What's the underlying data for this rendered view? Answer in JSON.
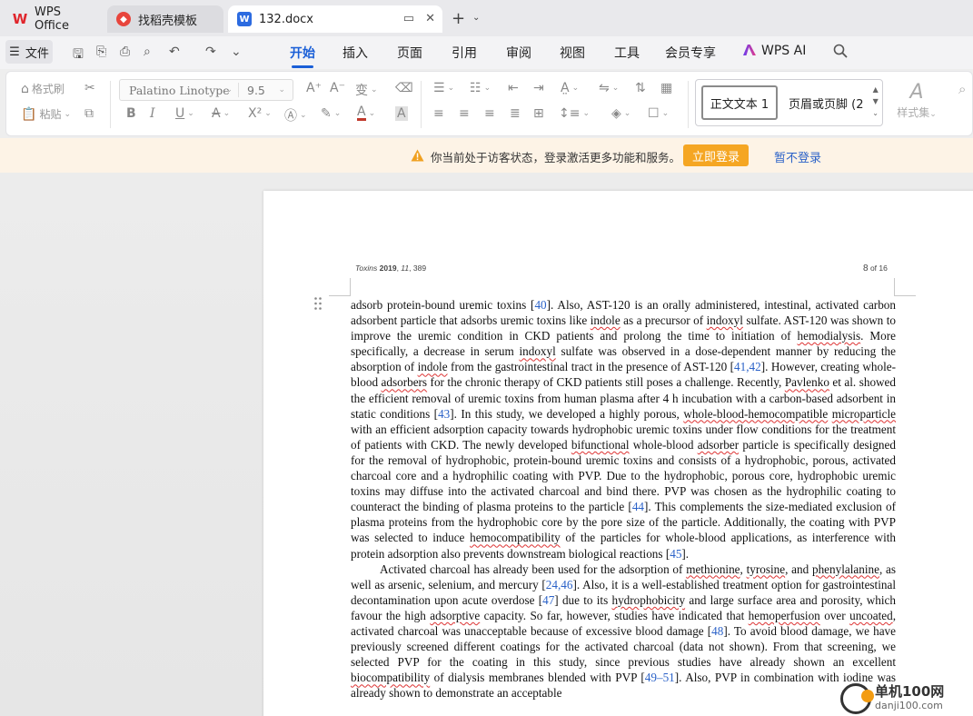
{
  "tabs": [
    {
      "label": "WPS Office"
    },
    {
      "label": "找稻壳模板"
    },
    {
      "label": "132.docx"
    }
  ],
  "menubar": {
    "file": "文件",
    "items": [
      "开始",
      "插入",
      "页面",
      "引用",
      "审阅",
      "视图",
      "工具",
      "会员专享",
      "WPS AI"
    ],
    "active": "开始"
  },
  "ribbon": {
    "format_painter": "格式刷",
    "paste": "粘贴",
    "font_name": "Palatino Linotype",
    "font_size": "9.5",
    "style_normal": "正文文本 1",
    "style_header": "页眉或页脚 (2",
    "style_set": "样式集"
  },
  "notice": {
    "text": "你当前处于访客状态，登录激活更多功能和服务。",
    "login": "立即登录",
    "skip": "暂不登录"
  },
  "document": {
    "running_head_journal": "Toxins",
    "running_head_year": "2019",
    "running_head_vol": "11",
    "running_head_page": "389",
    "page_num": "8",
    "page_of": "of 16"
  },
  "watermark": {
    "cn": "单机100网",
    "url": "danji100.com"
  },
  "colors": {
    "accent": "#1a5fd7",
    "login_button": "#f5a623",
    "notice_bg": "#fdf3e6",
    "citation": "#2b62c8"
  }
}
